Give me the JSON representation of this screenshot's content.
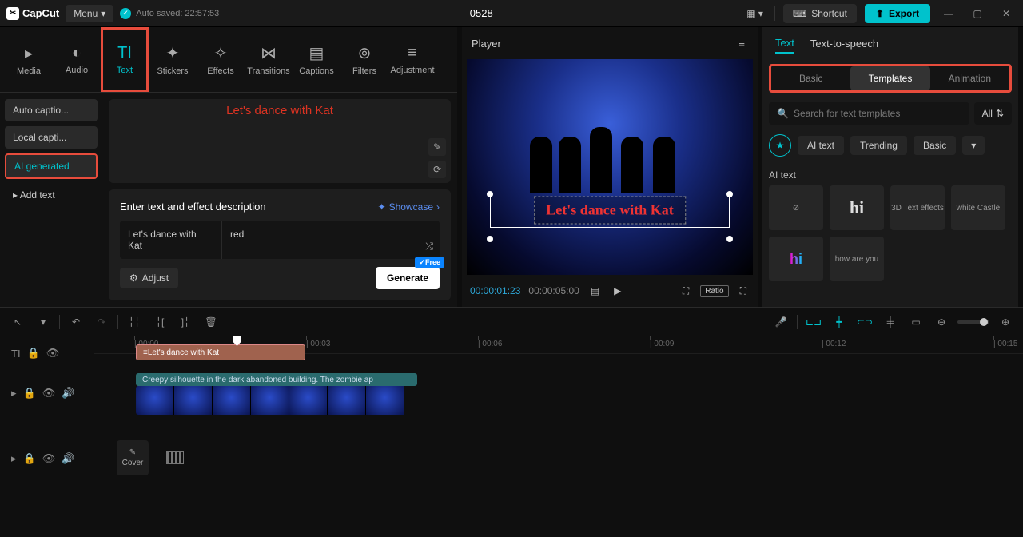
{
  "titlebar": {
    "app_name": "CapCut",
    "menu_label": "Menu",
    "autosave_label": "Auto saved: 22:57:53",
    "project_title": "0528",
    "shortcut_label": "Shortcut",
    "export_label": "Export"
  },
  "tool_tabs": [
    {
      "label": "Media",
      "icon": "▸"
    },
    {
      "label": "Audio",
      "icon": "◐"
    },
    {
      "label": "Text",
      "icon": "TI",
      "active": true
    },
    {
      "label": "Stickers",
      "icon": "✦"
    },
    {
      "label": "Effects",
      "icon": "✧"
    },
    {
      "label": "Transitions",
      "icon": "⋈"
    },
    {
      "label": "Captions",
      "icon": "▤"
    },
    {
      "label": "Filters",
      "icon": "⊚"
    },
    {
      "label": "Adjustment",
      "icon": "≡"
    }
  ],
  "side_buttons": {
    "auto": "Auto captio...",
    "local": "Local capti...",
    "ai": "AI generated",
    "add": "Add text"
  },
  "text_preview": "Let's dance with Kat",
  "desc": {
    "title": "Enter text and effect description",
    "showcase": "Showcase",
    "text_value": "Let's dance with Kat",
    "style_value": "red",
    "adjust": "Adjust",
    "generate": "Generate",
    "free": "Free"
  },
  "player": {
    "title": "Player",
    "overlay_text": "Let's dance with Kat",
    "time_current": "00:00:01:23",
    "time_total": "00:00:05:00",
    "ratio": "Ratio"
  },
  "right": {
    "tab_text": "Text",
    "tab_tts": "Text-to-speech",
    "subtabs": {
      "basic": "Basic",
      "templates": "Templates",
      "animation": "Animation"
    },
    "search_placeholder": "Search for text templates",
    "all": "All",
    "chips": {
      "ai": "AI text",
      "trending": "Trending",
      "basic": "Basic"
    },
    "section": "AI text",
    "templates": [
      {
        "label": "⊘"
      },
      {
        "label": "hi",
        "style": "hi"
      },
      {
        "label": "3D Text effects"
      },
      {
        "label": "white Castle"
      },
      {
        "label": "hi",
        "style": "color"
      },
      {
        "label": "how are you"
      }
    ]
  },
  "timeline": {
    "ticks": [
      "00:00",
      "00:03",
      "00:06",
      "00:09",
      "00:12",
      "00:15"
    ],
    "text_clip": "Let's dance with Kat",
    "video_label": "Creepy silhouette in the dark abandoned building. The zombie ap",
    "cover": "Cover"
  }
}
